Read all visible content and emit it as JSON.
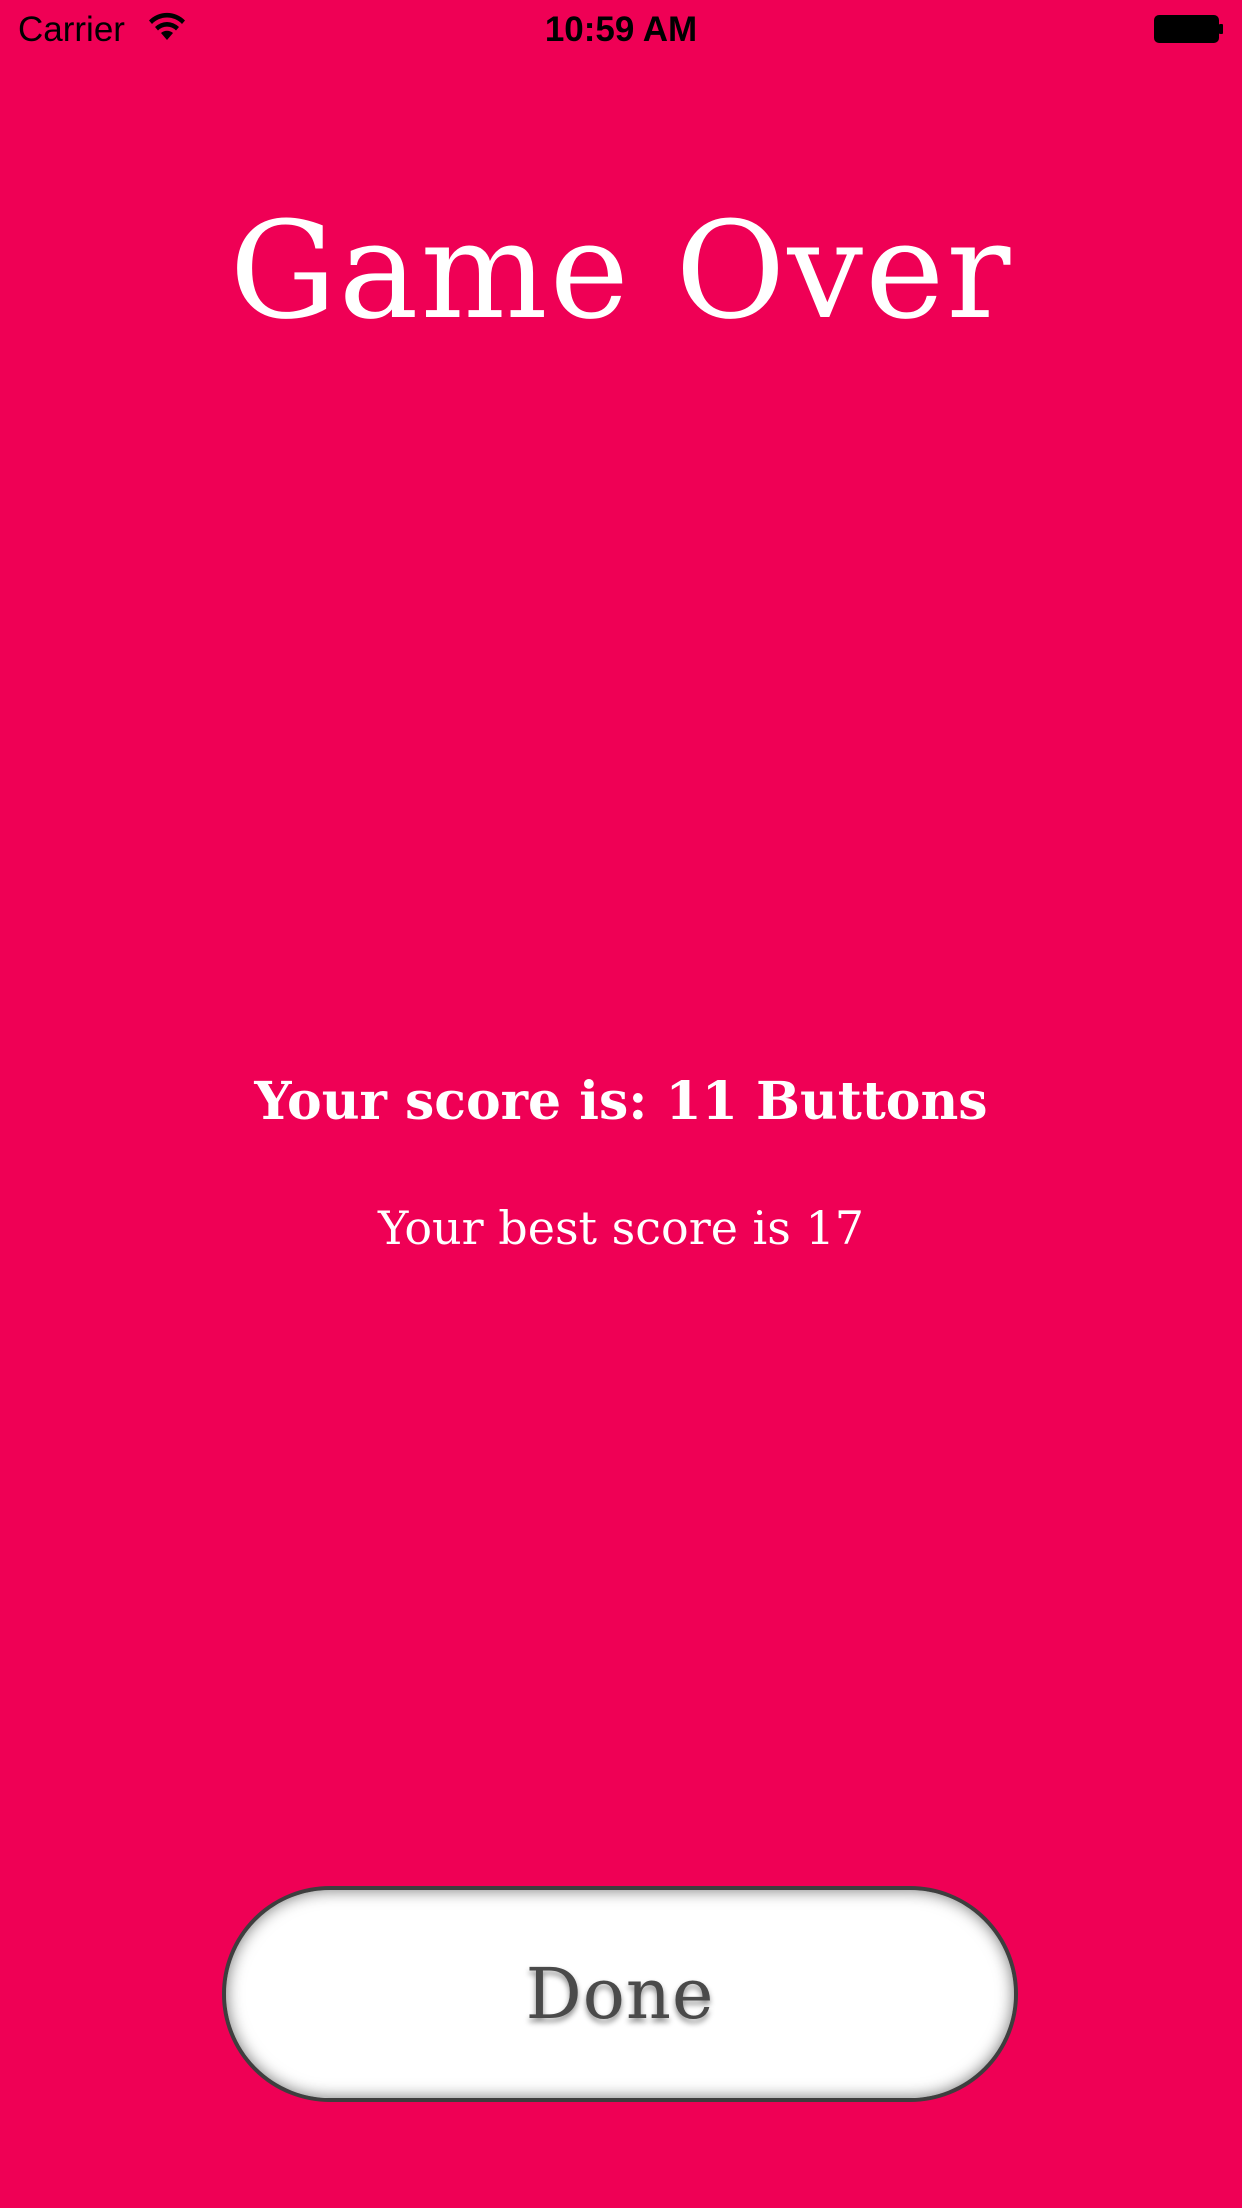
{
  "status_bar": {
    "carrier": "Carrier",
    "time": "10:59 AM",
    "wifi_icon": "wifi-icon",
    "battery_icon": "battery-icon"
  },
  "screen": {
    "background_color": "#EF0055",
    "title": "Game Over",
    "score_text": "Your score is: 11 Buttons",
    "best_score_text": "Your best score is 17"
  },
  "done_button": {
    "label": "Done"
  }
}
